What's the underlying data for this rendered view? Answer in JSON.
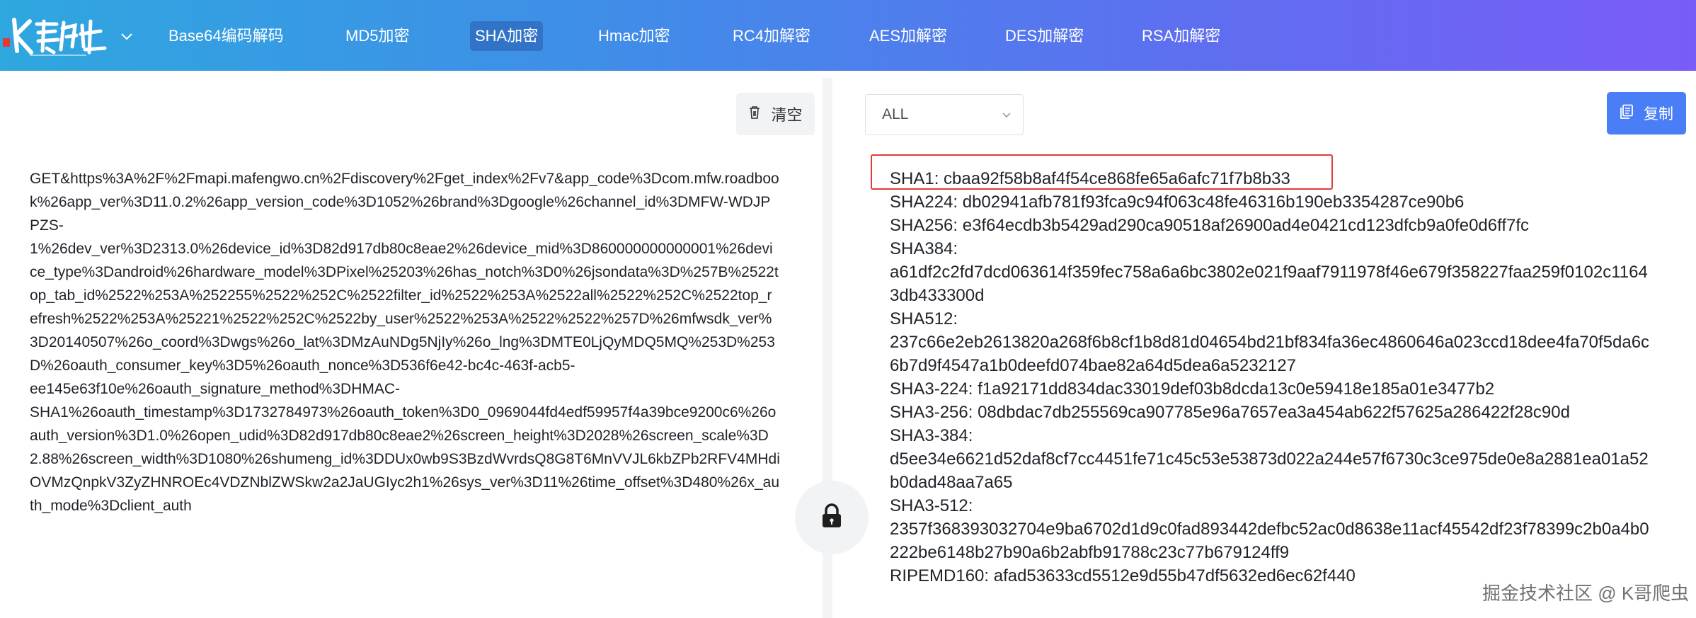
{
  "header": {
    "logo_text": "K哥爬虫",
    "nav": [
      {
        "label": "Base64编码解码",
        "active": false
      },
      {
        "label": "MD5加密",
        "active": false
      },
      {
        "label": "SHA加密",
        "active": true
      },
      {
        "label": "Hmac加密",
        "active": false
      },
      {
        "label": "RC4加解密",
        "active": false
      },
      {
        "label": "AES加解密",
        "active": false
      },
      {
        "label": "DES加解密",
        "active": false
      },
      {
        "label": "RSA加解密",
        "active": false
      }
    ]
  },
  "left": {
    "clear_label": "清空",
    "input_text": "GET&https%3A%2F%2Fmapi.mafengwo.cn%2Fdiscovery%2Fget_index%2Fv7&app_code%3Dcom.mfw.roadbook%26app_ver%3D11.0.2%26app_version_code%3D1052%26brand%3Dgoogle%26channel_id%3DMFW-WDJPPZS-\n1%26dev_ver%3D2313.0%26device_id%3D82d917db80c8eae2%26device_mid%3D860000000000001%26device_type%3Dandroid%26hardware_model%3DPixel%25203%26has_notch%3D0%26jsondata%3D%257B%2522top_tab_id%2522%253A%252255%2522%252C%2522filter_id%2522%253A%2522all%2522%252C%2522top_refresh%2522%253A%25221%2522%252C%2522by_user%2522%253A%2522%2522%257D%26mfwsdk_ver%3D20140507%26o_coord%3Dwgs%26o_lat%3DMzAuNDg5NjIy%26o_lng%3DMTE0LjQyMDQ5MQ%253D%253D%26oauth_consumer_key%3D5%26oauth_nonce%3D536f6e42-bc4c-463f-acb5-\nee145e63f10e%26oauth_signature_method%3DHMAC-\nSHA1%26oauth_timestamp%3D1732784973%26oauth_token%3D0_0969044fd4edf59957f4a39bce9200c6%26oauth_version%3D1.0%26open_udid%3D82d917db80c8eae2%26screen_height%3D2028%26screen_scale%3D2.88%26screen_width%3D1080%26shumeng_id%3DDUx0wb9S3BzdWvrdsQ8G8T6MnVVJL6kbZPb2RFV4MHdiOVMzQnpkV3ZyZHNROEc4VDZNblZWSkw2a2JaUGIyc2h1%26sys_ver%3D11%26time_offset%3D480%26x_auth_mode%3Dclient_auth"
  },
  "right": {
    "algorithm_select": "ALL",
    "copy_label": "复制",
    "results": [
      "SHA1: cbaa92f58b8af4f54ce868fe65a6afc71f7b8b33",
      "SHA224: db02941afb781f93fca9c94f063c48fe46316b190eb3354287ce90b6",
      "SHA256: e3f64ecdb3b5429ad290ca90518af26900ad4e0421cd123dfcb9a0fe0d6ff7fc",
      "SHA384:",
      "a61df2c2fd7dcd063614f359fec758a6a6bc3802e021f9aaf7911978f46e679f358227faa259f0102c11643db433300d",
      "SHA512:",
      "237c66e2eb2613820a268f6b8cf1b8d81d04654bd21bf834fa36ec4860646a023ccd18dee4fa70f5da6c6b7d9f4547a1b0deefd074bae82a64d5dea6a5232127",
      "SHA3-224: f1a92171dd834dac33019def03b8dcda13c0e59418e185a01e3477b2",
      "SHA3-256: 08dbdac7db255569ca907785e96a7657ea3a454ab622f57625a286422f28c90d",
      "SHA3-384:",
      "d5ee34e6621d52daf8cf7cc4451fe71c45c53e53873d022a244e57f6730c3ce975de0e8a2881ea01a52b0dad48aa7a65",
      "SHA3-512:",
      "2357f368393032704e9ba6702d1d9c0fad893442defbc52ac0d8638e11acf45542df23f78399c2b0a4b0222be6148b27b90a6b2abfb91788c23c77b679124ff9",
      "RIPEMD160: afad53633cd5512e9d55b47df5632ed6ec62f440"
    ]
  },
  "watermark": "掘金技术社区 @ K哥爬虫",
  "colors": {
    "header_gradient_start": "#2fa7df",
    "header_gradient_end": "#7a5cf7",
    "copy_button": "#4a7ef6",
    "highlight_border": "#e43a3a"
  }
}
